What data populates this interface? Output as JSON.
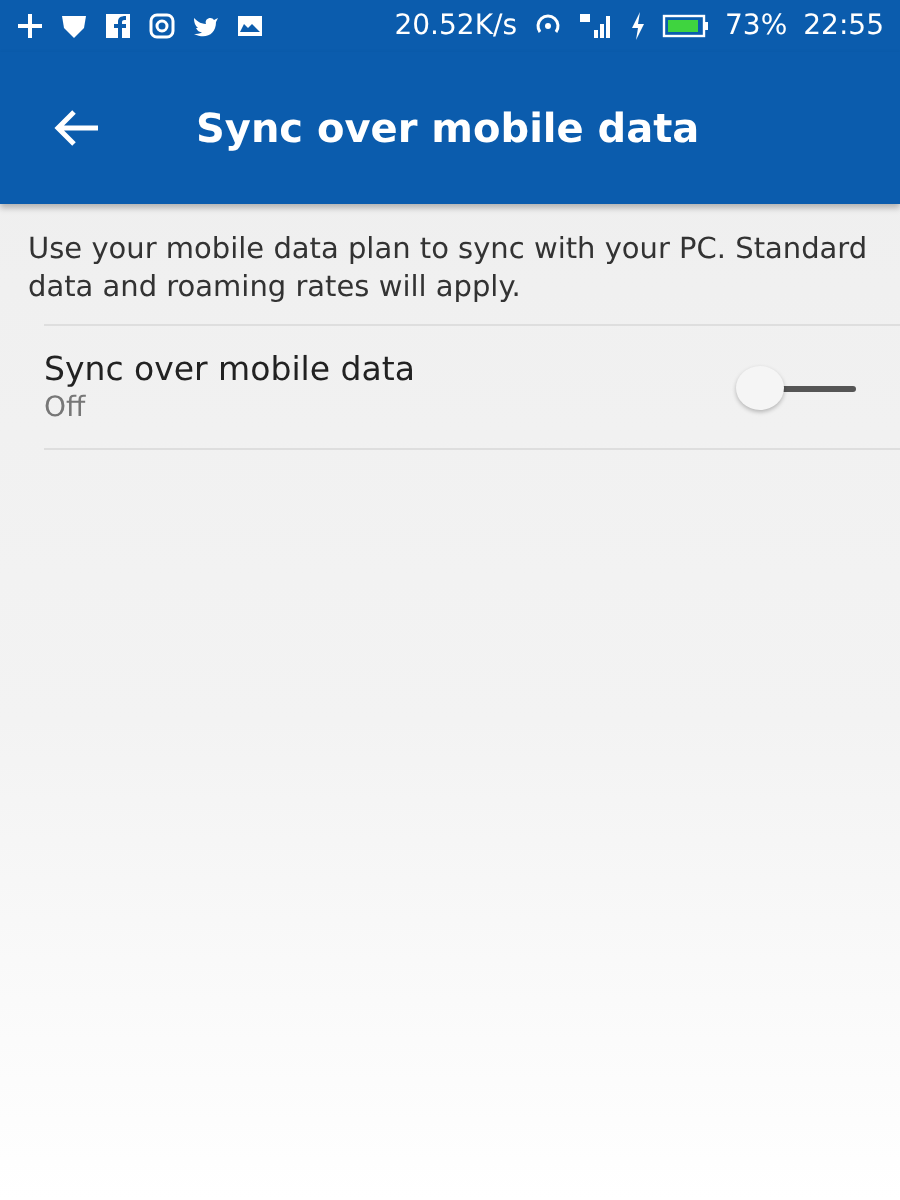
{
  "status_bar": {
    "speed": "20.52K/s",
    "battery": "73%",
    "time": "22:55"
  },
  "app_bar": {
    "title": "Sync over mobile data"
  },
  "description": "Use your mobile data plan to sync with your PC. Standard data and roaming rates will apply.",
  "setting": {
    "label": "Sync over mobile data",
    "value": "Off",
    "on": false
  }
}
